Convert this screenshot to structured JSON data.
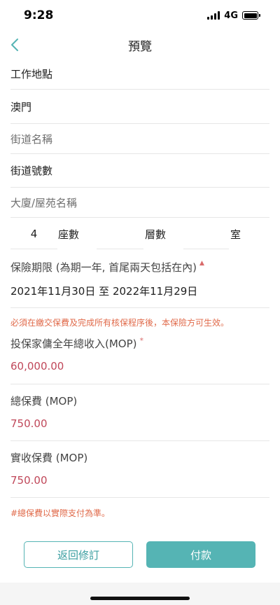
{
  "status_bar": {
    "time": "9:28",
    "network": "4G"
  },
  "nav": {
    "title": "預覽"
  },
  "work_location": {
    "label": "工作地點",
    "area": "澳門",
    "street_name_placeholder": "街道名稱",
    "street_number": "街道號數",
    "building_placeholder": "大廈/屋苑名稱",
    "block_value": "4",
    "block_label": "座數",
    "floor_label": "層數",
    "room_label": "室"
  },
  "insurance_period": {
    "label": "保險期限 (為期一年, 首尾兩天包括在內)",
    "required_mark": "▲",
    "start": "2021年11月30日",
    "separator": "至",
    "end": "2022年11月29日"
  },
  "notice": "必須在繳交保費及完成所有核保程序後，本保險方可生效。",
  "income": {
    "label": "投保家傭全年總收入(MOP)",
    "required_mark": "*",
    "value": "60,000.00"
  },
  "total_premium": {
    "label": "總保費 (MOP)",
    "value": "750.00"
  },
  "actual_premium": {
    "label": "實收保費 (MOP)",
    "value": "750.00"
  },
  "footnote": "#總保費以實際支付為準。",
  "buttons": {
    "back_label": "返回修訂",
    "pay_label": "付款"
  },
  "colors": {
    "accent": "#55b4b4",
    "money": "#c0485a",
    "notice": "#e06a4a"
  }
}
